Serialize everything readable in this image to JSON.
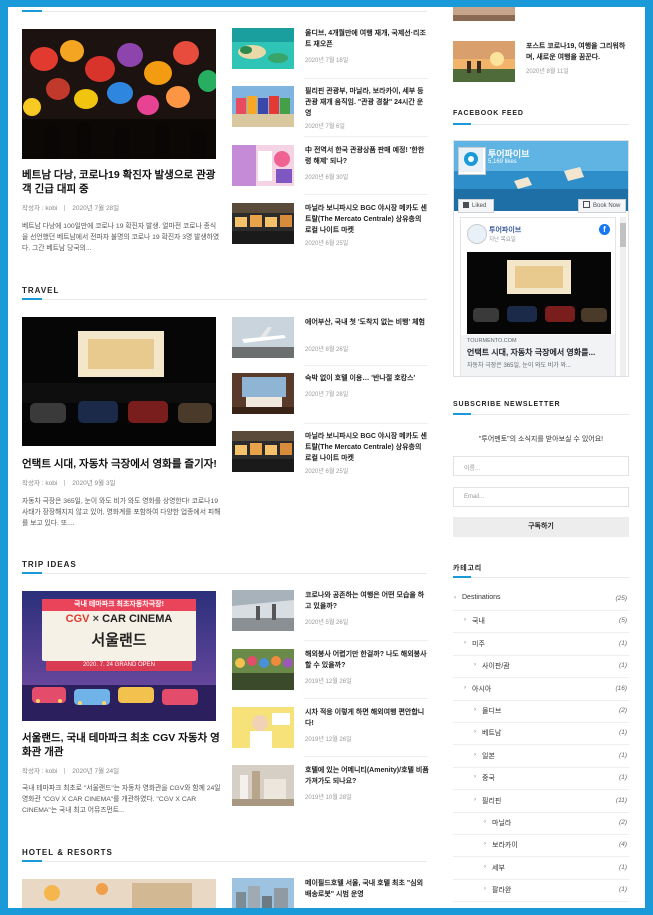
{
  "sections": [
    {
      "title": "",
      "featured": {
        "title": "베트남 다낭, 코로나19 확진자 발생으로 관광객 긴급 대피 중",
        "author_label": "작성자 : kobi",
        "date": "2020년 7월 28일",
        "excerpt": "베트남 다낭에 100일만에 코로나 19 확진자 발생. 얼마전 코로나 종식을 선언했던 베트남에서 전파자 불명의 코로나 19 확진자 3명 발생하였다. 그간 베트남 당국의..."
      },
      "items": [
        {
          "title": "올디브, 4개월만에 여행 재개, 국제선·리조트 재오픈",
          "date": "2020년 7월 16일"
        },
        {
          "title": "필리핀 관광부, 마닐라, 보라카이, 세부 등 관광 재개 움직임. \"관광 경찰\" 24시간 운영",
          "date": "2020년 7월 6일"
        },
        {
          "title": "中 전역서 한국 관광상품 판매 예정! '한한령 해제' 되나?",
          "date": "2020년 6월 30일"
        },
        {
          "title": "마닐라 보니파시오 BGC 야시장 메카도 센트랄(The Mercato Centrale) 상유층의 로컬 나이트 마켓",
          "date": "2020년 6월 25일"
        }
      ]
    },
    {
      "title": "TRAVEL",
      "featured": {
        "title": "언택트 시대, 자동차 극장에서 영화를 즐기자!",
        "author_label": "작성자 : kobi",
        "date": "2020년 9월 3일",
        "excerpt": "자동차 극장은 365일, 눈이 와도 비가 와도 영화를 상영한다! 코로나19 사태가 장장해지지 않고 있어, 영화계를 포함하여 다양한 업종에서 피해를 보고 있다. 또...."
      },
      "items": [
        {
          "title": "에어부산, 국내 첫 '도착지 없는 비행' 체험",
          "date": "2020년 8월 26일"
        },
        {
          "title": "숙박 없이 호텔 이용… '반나절 호캉스'",
          "date": "2020년 7월 28일"
        },
        {
          "title": "마닐라 보니파시오 BGC 야시장 메카도 센트랄(The Mercato Centrale) 상유층의 로컬 나이트 마켓",
          "date": "2020년 6월 25일"
        }
      ]
    },
    {
      "title": "TRIP IDEAS",
      "featured": {
        "title": "서울랜드, 국내 테마파크 최초 CGV 자동차 영화관 개관",
        "author_label": "작성자 : kobi",
        "date": "2020년 7월 24일",
        "excerpt": "국내 테마파크 최초로 \"서울랜드\"는 자동차 영화관을 CGV와 함께 24일 영화관 \"CGV X CAR CINEMA\"를 개관하였다. \"CGV X CAR CINEMA\"는 국내 최고 어뮤즈먼트..."
      },
      "items": [
        {
          "title": "코로나와 공존하는 여행은 어떤 모습을 하고 있을까?",
          "date": "2020년 5월 26일"
        },
        {
          "title": "해외봉사 어렵기만 한걸까? 나도 해외봉사 할 수 있을까?",
          "date": "2019년 12월 26일"
        },
        {
          "title": "시차 적응 이렇게 하면 해외여행 편안합니다!",
          "date": "2019년 12월 26일"
        },
        {
          "title": "호텔에 있는 어메니티(Amenity)/호텔 비품 가져가도 되나요?",
          "date": "2019년 10월 28일"
        }
      ]
    },
    {
      "title": "HOTEL & RESORTS",
      "items": [
        {
          "title": "메이필드호텔 서울, 국내 호텔 최초 \"심외 배송로봇\" 시범 운영",
          "date": ""
        }
      ]
    }
  ],
  "poster": {
    "line1": "국내 테마파크 최초자동차극장!",
    "brand": "CGV",
    "brand_x": "×",
    "brand2": "CAR CINEMA",
    "place": "서울랜드",
    "date": "2020. 7. 24 GRAND OPEN"
  },
  "sidebar": {
    "top_post": {
      "title": "포스트 코로나19, 여행을 그리워하며, 새로운 여행을 꿈꾼다.",
      "date": "2020년 8월 11일"
    },
    "facebook": {
      "title": "FACEBOOK FEED",
      "page_name": "투어파이브",
      "likes": "5,169 likes",
      "liked_label": "Liked",
      "book_label": "Book Now",
      "post_author": "투어파이브",
      "post_time": "지난 목요일",
      "post_domain": "TOURMENTO.COM",
      "post_title": "언택트 시대, 자동차 극장에서 영화를...",
      "post_text": "자동차 극장은 365일, 눈이 와도 비가 와..."
    },
    "newsletter": {
      "title": "SUBSCRIBE NEWSLETTER",
      "desc": "\"투어멘토\"의 소식지를 받아보실 수 있어요!",
      "name_placeholder": "이름...",
      "email_placeholder": "Email...",
      "button": "구독하기"
    },
    "categories": {
      "title": "카테고리",
      "items": [
        {
          "name": "Destinations",
          "count": "(25)",
          "level": 0
        },
        {
          "name": "국내",
          "count": "(5)",
          "level": 1
        },
        {
          "name": "미주",
          "count": "(1)",
          "level": 1
        },
        {
          "name": "사이판/괌",
          "count": "(1)",
          "level": 2
        },
        {
          "name": "아시아",
          "count": "(16)",
          "level": 1
        },
        {
          "name": "몰디브",
          "count": "(2)",
          "level": 2
        },
        {
          "name": "베트남",
          "count": "(1)",
          "level": 2
        },
        {
          "name": "일본",
          "count": "(1)",
          "level": 2
        },
        {
          "name": "중국",
          "count": "(1)",
          "level": 2
        },
        {
          "name": "필리핀",
          "count": "(11)",
          "level": 2
        },
        {
          "name": "마닐라",
          "count": "(2)",
          "level": 3
        },
        {
          "name": "보라카이",
          "count": "(4)",
          "level": 3
        },
        {
          "name": "세부",
          "count": "(1)",
          "level": 3
        },
        {
          "name": "팔라완",
          "count": "(1)",
          "level": 3
        }
      ]
    }
  },
  "colors": {
    "accent": "#1a9ad9",
    "fb_blue": "#1877f2"
  }
}
